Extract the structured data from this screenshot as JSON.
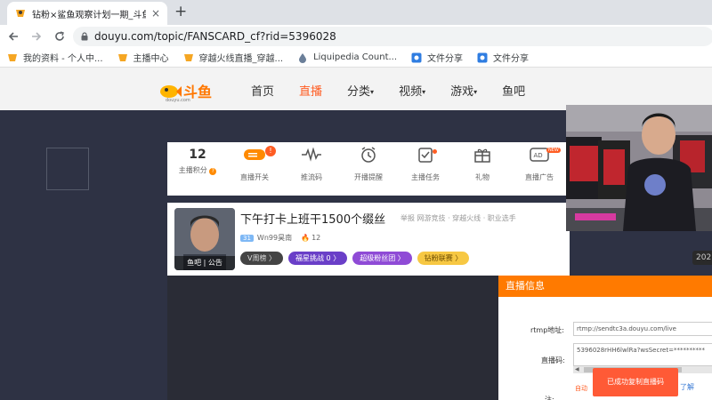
{
  "browser": {
    "tab_title": "钻粉×鲨鱼观察计划一期_斗鱼",
    "close_glyph": "×",
    "new_tab_glyph": "+",
    "url": "douyu.com/topic/FANSCARD_cf?rid=5396028",
    "bookmarks": [
      {
        "label": "我的资料 - 个人中..."
      },
      {
        "label": "主播中心"
      },
      {
        "label": "穿越火线直播_穿越..."
      },
      {
        "label": "Liquipedia Count..."
      },
      {
        "label": "文件分享"
      },
      {
        "label": "文件分享"
      }
    ]
  },
  "site": {
    "logo_text": "斗鱼",
    "logo_sub": "douyu.com",
    "nav": [
      {
        "label": "首页"
      },
      {
        "label": "直播",
        "active": true
      },
      {
        "label": "分类"
      },
      {
        "label": "视频"
      },
      {
        "label": "游戏"
      },
      {
        "label": "鱼吧"
      }
    ],
    "caret": "▾"
  },
  "dashboard": {
    "score_value": "12",
    "q_mark": "?",
    "excl_mark": "!",
    "new_badge": "NEW",
    "items": [
      {
        "label": "主播积分"
      },
      {
        "label": "直播开关"
      },
      {
        "label": "推流码"
      },
      {
        "label": "开播提醒"
      },
      {
        "label": "主播任务"
      },
      {
        "label": "礼物"
      },
      {
        "label": "直播广告"
      }
    ]
  },
  "room": {
    "title": "下午打卡上班干1500个缀丝",
    "tags": "举报    网游竞技 · 穿越火线 · 职业选手",
    "level": "31",
    "name": "Wn99昊南",
    "heat": "12",
    "avatar_bar": "鱼吧 | 公告",
    "pills": [
      {
        "label": "V周榜 〉"
      },
      {
        "label": "福星挑战 0 〉"
      },
      {
        "label": "超级粉丝团 〉"
      },
      {
        "label": "钻粉联赛 〉"
      }
    ],
    "year_badge": "202"
  },
  "live_info": {
    "header": "直播信息",
    "rtmp_label": "rtmp地址:",
    "rtmp_value": "rtmp://sendtc3a.douyu.com/live",
    "code_label": "直播码:",
    "code_value": "5396028rHH6lwlRa?wsSecret=**********",
    "note_label": "注:",
    "auto_text": "自动",
    "learn": "了解",
    "scroll_left": "◀"
  },
  "toast": "已成功复制直播码",
  "colors": {
    "accent": "#ff7a00",
    "nav_active": "#ff5d23",
    "page_bg": "#2e3244"
  }
}
